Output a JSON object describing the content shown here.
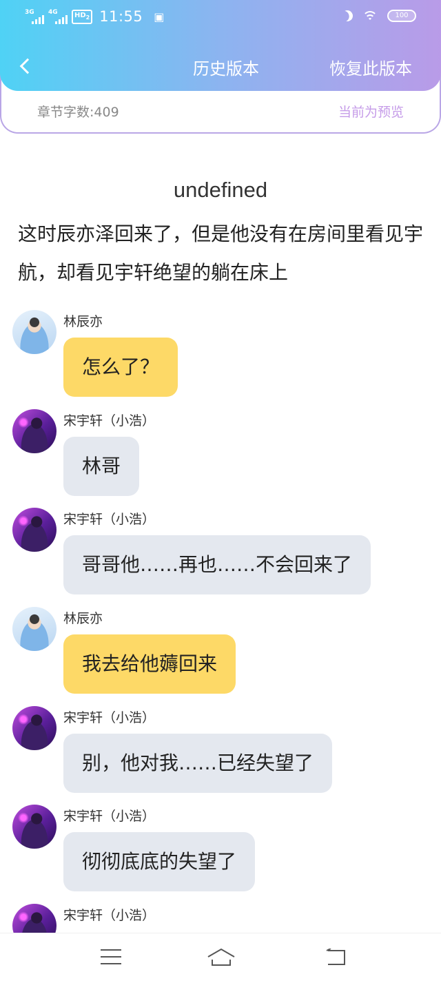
{
  "status_bar": {
    "net1": "3G",
    "net2": "4G",
    "hd_label": "HD",
    "hd_sub": "2",
    "time": "11:55",
    "battery": "100"
  },
  "header": {
    "title": "历史版本",
    "action": "恢复此版本"
  },
  "info": {
    "word_count": "章节字数:409",
    "status": "当前为预览"
  },
  "chapter": {
    "title": "undefined",
    "narration": "这时辰亦泽回来了，但是他没有在房间里看见宇航，却看见宇轩绝望的躺在床上"
  },
  "messages": [
    {
      "sender": "林辰亦",
      "text": "怎么了？",
      "style": "yellow"
    },
    {
      "sender": "宋宇轩（小浩）",
      "text": "林哥",
      "style": "gray"
    },
    {
      "sender": "宋宇轩（小浩）",
      "text": "哥哥他……再也……不会回来了",
      "style": "gray"
    },
    {
      "sender": "林辰亦",
      "text": "我去给他薅回来",
      "style": "yellow"
    },
    {
      "sender": "宋宇轩（小浩）",
      "text": "别，他对我……已经失望了",
      "style": "gray"
    },
    {
      "sender": "宋宇轩（小浩）",
      "text": "彻彻底底的失望了",
      "style": "gray"
    },
    {
      "sender": "宋宇轩（小浩）",
      "text": "",
      "style": "gray"
    }
  ],
  "icons": {
    "back": "chevron-left-icon",
    "menu": "menu-icon",
    "home": "home-icon",
    "nav_back": "return-icon"
  },
  "colors": {
    "header_gradient_start": "#4fd2f5",
    "header_gradient_end": "#b99be8",
    "yellow_bubble": "#fdd967",
    "gray_bubble": "#e4e8ef",
    "preview_text": "#c59be8"
  }
}
